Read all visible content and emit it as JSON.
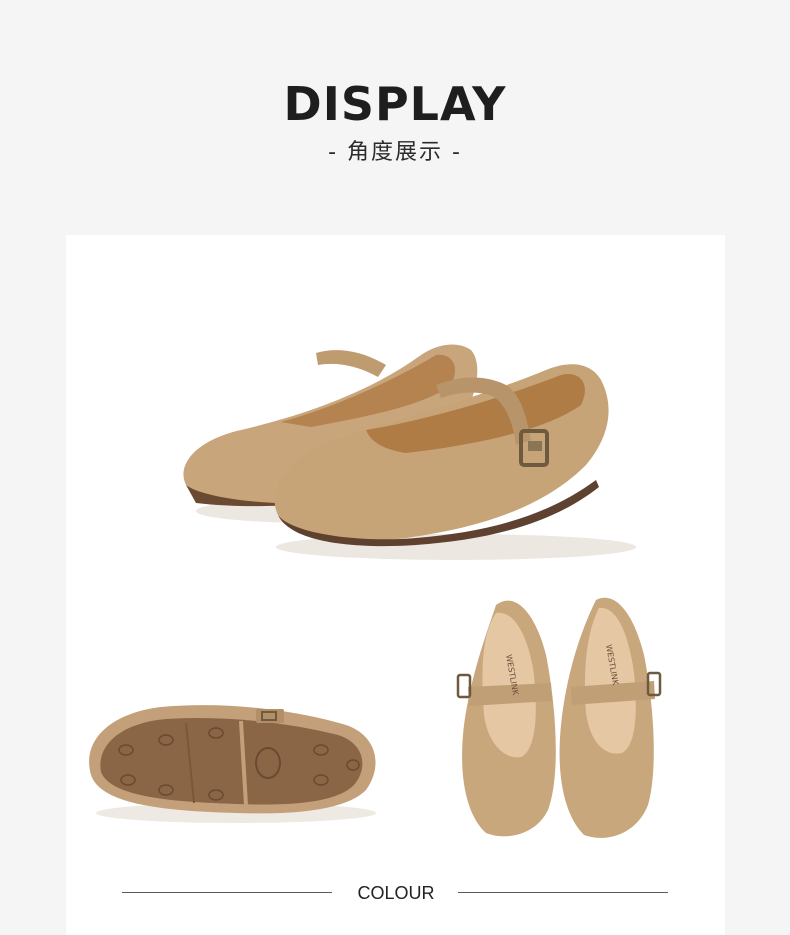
{
  "heading": {
    "title": "DISPLAY",
    "subtitle": "-  角度展示  -"
  },
  "section": {
    "colour_label": "COLOUR"
  },
  "product": {
    "brand_text": "WESTLINK",
    "colors": {
      "suede": "#c9a57b",
      "suede_shadow": "#a9855c",
      "lining": "#e6c7a4",
      "sole": "#6b4a32",
      "outsole_rubber": "#8a6647"
    }
  }
}
